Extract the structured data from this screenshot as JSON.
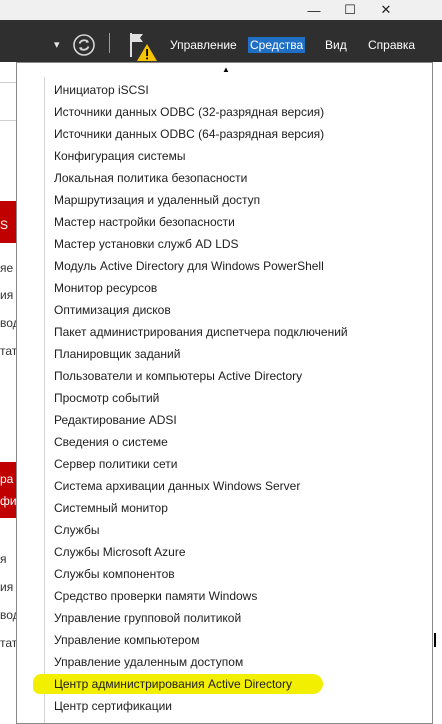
{
  "window": {
    "minimize_glyph": "—",
    "maximize_glyph": "☐",
    "close_glyph": "✕"
  },
  "toolbar": {
    "dropdown_arrow_glyph": "▾",
    "refresh_icon": "refresh-icon",
    "notifications_icon": "flag-icon",
    "warning_icon": "warning-icon"
  },
  "menu": {
    "items": [
      {
        "label": "Управление",
        "active": false
      },
      {
        "label": "Средства",
        "active": true
      },
      {
        "label": "Вид",
        "active": false
      },
      {
        "label": "Справка",
        "active": false
      }
    ]
  },
  "background_panel": {
    "fragments": [
      "S",
      "яе",
      "ия",
      "вод",
      "тат",
      "ра",
      "фи",
      "я",
      "ия",
      "вод",
      "тат"
    ]
  },
  "dropdown": {
    "pointer_glyph": "▲",
    "items": [
      "Инициатор iSCSI",
      "Источники данных ODBC (32-разрядная версия)",
      "Источники данных ODBC (64-разрядная версия)",
      "Конфигурация системы",
      "Локальная политика безопасности",
      "Маршрутизация и удаленный доступ",
      "Мастер настройки безопасности",
      "Мастер установки служб AD LDS",
      "Модуль Active Directory для Windows PowerShell",
      "Монитор ресурсов",
      "Оптимизация дисков",
      "Пакет администрирования диспетчера подключений",
      "Планировщик заданий",
      "Пользователи и компьютеры Active Directory",
      "Просмотр событий",
      "Редактирование ADSI",
      "Сведения о системе",
      "Сервер политики сети",
      "Система архивации данных Windows Server",
      "Системный монитор",
      "Службы",
      "Службы Microsoft Azure",
      "Службы компонентов",
      "Средство проверки памяти Windows",
      "Управление групповой политикой",
      "Управление компьютером",
      "Управление удаленным доступом",
      "Центр администрирования Active Directory",
      "Центр сертификации"
    ],
    "highlighted_index": 27,
    "highlight_color": "#f2f000"
  },
  "colors": {
    "header_bg": "#2f2f2f",
    "active_menu_bg": "#1f6fc5",
    "accent_red": "#c00000"
  }
}
